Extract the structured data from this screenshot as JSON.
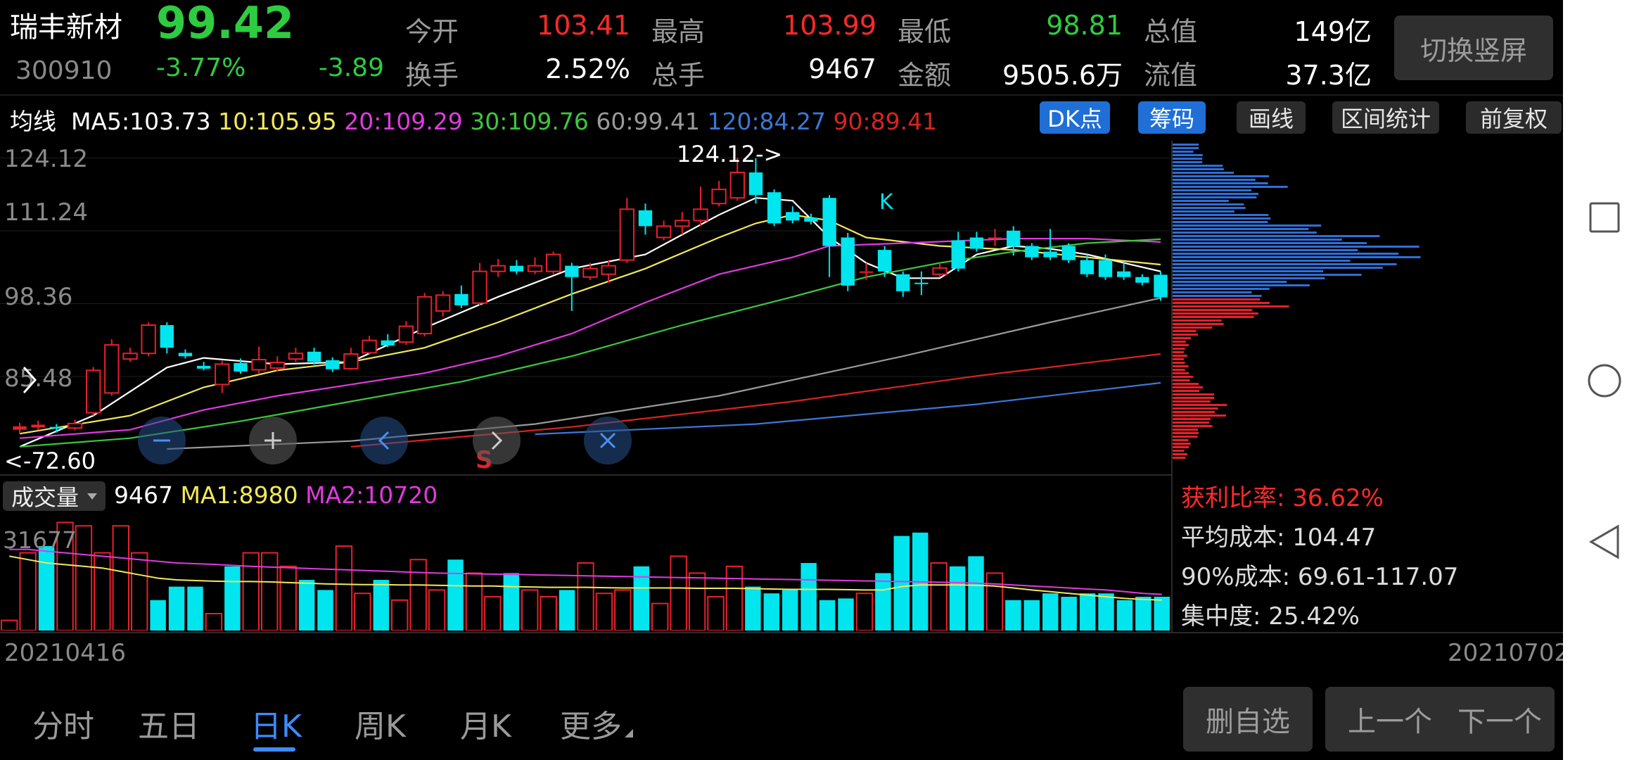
{
  "header": {
    "stock_name": "瑞丰新材",
    "price": "99.42",
    "code": "300910",
    "change_pct": "-3.77%",
    "change_abs": "-3.89",
    "open_label": "今开",
    "open_val": "103.41",
    "high_label": "最高",
    "high_val": "103.99",
    "low_label": "最低",
    "low_val": "98.81",
    "mcap_label": "总值",
    "mcap_val": "149亿",
    "turnover_label": "换手",
    "turnover_val": "2.52%",
    "hands_label": "总手",
    "hands_val": "9467",
    "amount_label": "金额",
    "amount_val": "9505.6万",
    "float_label": "流值",
    "float_val": "37.3亿",
    "switch_btn": "切换竖屏"
  },
  "ma_bar": {
    "title": "均线",
    "ma5": "MA5:103.73",
    "ma10": "10:105.95",
    "ma20": "20:109.29",
    "ma30": "30:109.76",
    "ma60": "60:99.41",
    "ma120": "120:84.27",
    "ma90": "90:89.41",
    "buttons": [
      "DK点",
      "筹码",
      "画线",
      "区间统计",
      "前复权"
    ]
  },
  "colors": {
    "up": "#e8202a",
    "down": "#00e5ee",
    "ma5": "#ffffff",
    "ma10": "#f2e85a",
    "ma20": "#e03ae0",
    "ma30": "#3cc83c",
    "ma60": "#9a9a9a",
    "ma120": "#3a78d8",
    "ma90": "#d8241f"
  },
  "icons": [
    "chevron-right-icon",
    "zoom-out-icon",
    "zoom-in-icon",
    "chevron-left-icon",
    "chevron-right-icon",
    "reset-icon",
    "square-nav-icon",
    "circle-nav-icon",
    "triangle-back-icon"
  ],
  "markers": {
    "high_label": "124.12->",
    "low_label": "<-72.60",
    "k_mark": "K",
    "s_mark": "S"
  },
  "volume_bar": {
    "selector": "成交量",
    "vol": "9467",
    "ma1": "MA1:8980",
    "ma2": "MA2:10720",
    "max_label": "31677"
  },
  "chip": {
    "profit_ratio": "获利比率: 36.62%",
    "avg_cost": "平均成本: 104.47",
    "cost90": "90%成本:  69.61-117.07",
    "concentration": "集中度: 25.42%"
  },
  "dates": {
    "start": "20210416",
    "end": "20210702"
  },
  "tabs": [
    "分时",
    "五日",
    "日K",
    "周K",
    "月K",
    "更多"
  ],
  "bottom_buttons": [
    "删自选",
    "上一个",
    "下一个"
  ],
  "chart_data": {
    "type": "candlestick",
    "y_tick_labels": [
      "124.12",
      "111.24",
      "98.36",
      "85.48",
      "72.60"
    ],
    "ylim": [
      72.6,
      124.12
    ],
    "x_range": [
      "20210416",
      "20210702"
    ],
    "candles": [
      {
        "o": 76.0,
        "c": 76.6,
        "h": 77.2,
        "l": 75.3
      },
      {
        "o": 76.4,
        "c": 76.9,
        "h": 77.6,
        "l": 75.9
      },
      {
        "o": 76.5,
        "c": 76.2,
        "h": 77.0,
        "l": 75.5
      },
      {
        "o": 76.3,
        "c": 77.1,
        "h": 77.8,
        "l": 75.9
      },
      {
        "o": 79.0,
        "c": 86.5,
        "h": 87.1,
        "l": 78.5
      },
      {
        "o": 82.5,
        "c": 91.0,
        "h": 92.0,
        "l": 82.0
      },
      {
        "o": 88.5,
        "c": 89.5,
        "h": 90.5,
        "l": 88.0
      },
      {
        "o": 89.5,
        "c": 94.5,
        "h": 95.0,
        "l": 89.0
      },
      {
        "o": 94.5,
        "c": 90.5,
        "h": 95.0,
        "l": 89.5
      },
      {
        "o": 89.6,
        "c": 89.0,
        "h": 90.2,
        "l": 88.6
      },
      {
        "o": 87.3,
        "c": 86.8,
        "h": 88.0,
        "l": 86.5
      },
      {
        "o": 84.0,
        "c": 87.6,
        "h": 88.2,
        "l": 82.5
      },
      {
        "o": 87.8,
        "c": 86.3,
        "h": 88.6,
        "l": 85.9
      },
      {
        "o": 86.6,
        "c": 88.4,
        "h": 90.7,
        "l": 85.8
      },
      {
        "o": 86.9,
        "c": 87.9,
        "h": 89.0,
        "l": 86.4
      },
      {
        "o": 88.5,
        "c": 89.5,
        "h": 90.5,
        "l": 88.0
      },
      {
        "o": 89.8,
        "c": 88.0,
        "h": 90.5,
        "l": 87.5
      },
      {
        "o": 88.3,
        "c": 86.7,
        "h": 88.8,
        "l": 86.2
      },
      {
        "o": 86.8,
        "c": 89.4,
        "h": 90.5,
        "l": 86.6
      },
      {
        "o": 89.6,
        "c": 91.8,
        "h": 92.6,
        "l": 89.4
      },
      {
        "o": 91.8,
        "c": 90.9,
        "h": 92.9,
        "l": 90.6
      },
      {
        "o": 91.5,
        "c": 94.3,
        "h": 95.2,
        "l": 91.0
      },
      {
        "o": 93.0,
        "c": 99.5,
        "h": 100.2,
        "l": 92.5
      },
      {
        "o": 97.0,
        "c": 99.8,
        "h": 100.5,
        "l": 96.0
      },
      {
        "o": 100.0,
        "c": 98.0,
        "h": 101.5,
        "l": 97.5
      },
      {
        "o": 98.4,
        "c": 104.0,
        "h": 105.5,
        "l": 98.0
      },
      {
        "o": 104.0,
        "c": 105.0,
        "h": 106.2,
        "l": 103.0
      },
      {
        "o": 105.0,
        "c": 104.0,
        "h": 106.0,
        "l": 103.5
      },
      {
        "o": 104.0,
        "c": 105.0,
        "h": 106.5,
        "l": 103.5
      },
      {
        "o": 104.0,
        "c": 107.0,
        "h": 107.5,
        "l": 103.5
      },
      {
        "o": 105.0,
        "c": 103.0,
        "h": 105.5,
        "l": 97.0
      },
      {
        "o": 103.0,
        "c": 104.5,
        "h": 105.5,
        "l": 102.5
      },
      {
        "o": 103.5,
        "c": 105.0,
        "h": 106.0,
        "l": 102.0
      },
      {
        "o": 106.0,
        "c": 115.0,
        "h": 117.0,
        "l": 105.5
      },
      {
        "o": 114.8,
        "c": 112.0,
        "h": 116.0,
        "l": 110.5
      },
      {
        "o": 110.0,
        "c": 112.0,
        "h": 113.0,
        "l": 109.5
      },
      {
        "o": 112.0,
        "c": 113.0,
        "h": 114.5,
        "l": 110.5
      },
      {
        "o": 113.0,
        "c": 115.0,
        "h": 119.0,
        "l": 112.0
      },
      {
        "o": 116.0,
        "c": 118.5,
        "h": 120.0,
        "l": 115.5
      },
      {
        "o": 117.0,
        "c": 121.5,
        "h": 124.12,
        "l": 116.5
      },
      {
        "o": 121.5,
        "c": 117.5,
        "h": 124.0,
        "l": 116.0
      },
      {
        "o": 118.0,
        "c": 112.5,
        "h": 118.5,
        "l": 112.0
      },
      {
        "o": 114.5,
        "c": 113.0,
        "h": 115.5,
        "l": 112.5
      },
      {
        "o": 113.5,
        "c": 112.8,
        "h": 114.2,
        "l": 112.3
      },
      {
        "o": 117.0,
        "c": 108.5,
        "h": 117.5,
        "l": 103.0
      },
      {
        "o": 110.0,
        "c": 101.5,
        "h": 110.8,
        "l": 100.5
      },
      {
        "o": 104.0,
        "c": 104.0,
        "h": 105.5,
        "l": 102.5
      },
      {
        "o": 107.8,
        "c": 104.0,
        "h": 108.5,
        "l": 103.0
      },
      {
        "o": 103.5,
        "c": 100.5,
        "h": 104.0,
        "l": 99.5
      },
      {
        "o": 102.0,
        "c": 101.8,
        "h": 104.0,
        "l": 99.8
      },
      {
        "o": 103.5,
        "c": 104.6,
        "h": 105.5,
        "l": 103.0
      },
      {
        "o": 109.5,
        "c": 104.5,
        "h": 111.0,
        "l": 104.0
      },
      {
        "o": 110.0,
        "c": 108.0,
        "h": 111.0,
        "l": 107.5
      },
      {
        "o": 110.0,
        "c": 110.0,
        "h": 111.5,
        "l": 108.5
      },
      {
        "o": 111.2,
        "c": 108.4,
        "h": 112.0,
        "l": 106.8
      },
      {
        "o": 108.5,
        "c": 106.5,
        "h": 109.0,
        "l": 106.0
      },
      {
        "o": 107.5,
        "c": 106.5,
        "h": 111.5,
        "l": 106.0
      },
      {
        "o": 108.5,
        "c": 106.0,
        "h": 109.0,
        "l": 105.5
      },
      {
        "o": 106.0,
        "c": 103.5,
        "h": 107.0,
        "l": 103.0
      },
      {
        "o": 106.0,
        "c": 103.0,
        "h": 107.0,
        "l": 102.5
      },
      {
        "o": 104.0,
        "c": 103.0,
        "h": 105.5,
        "l": 102.5
      },
      {
        "o": 103.0,
        "c": 102.0,
        "h": 103.5,
        "l": 101.5
      },
      {
        "o": 103.41,
        "c": 99.42,
        "h": 103.99,
        "l": 98.81
      }
    ],
    "ma_series": [
      {
        "name": "MA5",
        "color_key": "ma5",
        "points": [
          [
            0,
            73.0
          ],
          [
            4,
            78.5
          ],
          [
            8,
            87.0
          ],
          [
            10,
            88.7
          ],
          [
            14,
            87.6
          ],
          [
            18,
            88.0
          ],
          [
            22,
            94.0
          ],
          [
            26,
            99.5
          ],
          [
            30,
            104.5
          ],
          [
            34,
            107.0
          ],
          [
            38,
            114.0
          ],
          [
            40,
            117.0
          ],
          [
            42,
            116.5
          ],
          [
            44,
            110.0
          ],
          [
            46,
            105.5
          ],
          [
            48,
            102.8
          ],
          [
            50,
            102.8
          ],
          [
            52,
            107.0
          ],
          [
            54,
            108.5
          ],
          [
            56,
            108.0
          ],
          [
            58,
            107.0
          ],
          [
            60,
            105.5
          ],
          [
            62,
            104.0
          ]
        ]
      },
      {
        "name": "MA10",
        "color_key": "ma10",
        "points": [
          [
            0,
            75.3
          ],
          [
            6,
            78.5
          ],
          [
            10,
            83.5
          ],
          [
            14,
            86.5
          ],
          [
            18,
            88.0
          ],
          [
            22,
            90.5
          ],
          [
            26,
            95.0
          ],
          [
            30,
            100.0
          ],
          [
            34,
            104.5
          ],
          [
            38,
            110.0
          ],
          [
            40,
            112.5
          ],
          [
            42,
            114.0
          ],
          [
            44,
            113.0
          ],
          [
            46,
            110.0
          ],
          [
            50,
            108.5
          ],
          [
            54,
            107.8
          ],
          [
            58,
            106.5
          ],
          [
            62,
            105.2
          ]
        ]
      },
      {
        "name": "MA20",
        "color_key": "ma20",
        "points": [
          [
            0,
            74.5
          ],
          [
            6,
            76.0
          ],
          [
            10,
            79.5
          ],
          [
            14,
            82.0
          ],
          [
            18,
            84.0
          ],
          [
            22,
            86.0
          ],
          [
            26,
            89.0
          ],
          [
            30,
            93.0
          ],
          [
            34,
            98.5
          ],
          [
            38,
            103.5
          ],
          [
            42,
            106.5
          ],
          [
            44,
            108.5
          ],
          [
            48,
            109.0
          ],
          [
            54,
            109.8
          ],
          [
            58,
            109.8
          ],
          [
            62,
            109.2
          ]
        ]
      },
      {
        "name": "MA30",
        "color_key": "ma30",
        "points": [
          [
            0,
            73.0
          ],
          [
            6,
            74.5
          ],
          [
            12,
            77.5
          ],
          [
            18,
            81.0
          ],
          [
            24,
            84.5
          ],
          [
            30,
            89.0
          ],
          [
            36,
            94.5
          ],
          [
            42,
            99.5
          ],
          [
            46,
            103.0
          ],
          [
            50,
            105.5
          ],
          [
            54,
            107.5
          ],
          [
            58,
            109.0
          ],
          [
            62,
            109.7
          ]
        ]
      },
      {
        "name": "MA60",
        "color_key": "ma60",
        "points": [
          [
            8,
            72.6
          ],
          [
            18,
            74.0
          ],
          [
            28,
            77.0
          ],
          [
            38,
            82.0
          ],
          [
            48,
            89.0
          ],
          [
            56,
            95.0
          ],
          [
            62,
            99.3
          ]
        ]
      },
      {
        "name": "MA120",
        "color_key": "ma120",
        "points": [
          [
            28,
            75.2
          ],
          [
            40,
            77.0
          ],
          [
            52,
            80.5
          ],
          [
            62,
            84.3
          ]
        ]
      },
      {
        "name": "MA90",
        "color_key": "ma90",
        "points": [
          [
            18,
            73.0
          ],
          [
            30,
            76.5
          ],
          [
            42,
            81.0
          ],
          [
            52,
            85.5
          ],
          [
            62,
            89.4
          ]
        ]
      }
    ],
    "volumes": [
      3000,
      23000,
      25000,
      32000,
      31000,
      23000,
      31000,
      23000,
      9000,
      13000,
      13000,
      5000,
      19000,
      23000,
      23000,
      19000,
      15000,
      12000,
      25000,
      11000,
      15000,
      9000,
      21000,
      12000,
      21000,
      17000,
      10000,
      17000,
      12000,
      10000,
      12000,
      20000,
      11000,
      12000,
      19000,
      8000,
      22000,
      17000,
      10000,
      19000,
      13000,
      11000,
      12000,
      20000,
      9000,
      9500,
      11000,
      17000,
      28000,
      29000,
      20000,
      19000,
      22000,
      17000,
      9000,
      9000,
      11000,
      10000,
      11000,
      11000,
      9000,
      10000,
      10000
    ],
    "volume_max": 31677,
    "chip_distribution": {
      "note": "cost distribution histogram; blue above current price, red below"
    }
  }
}
